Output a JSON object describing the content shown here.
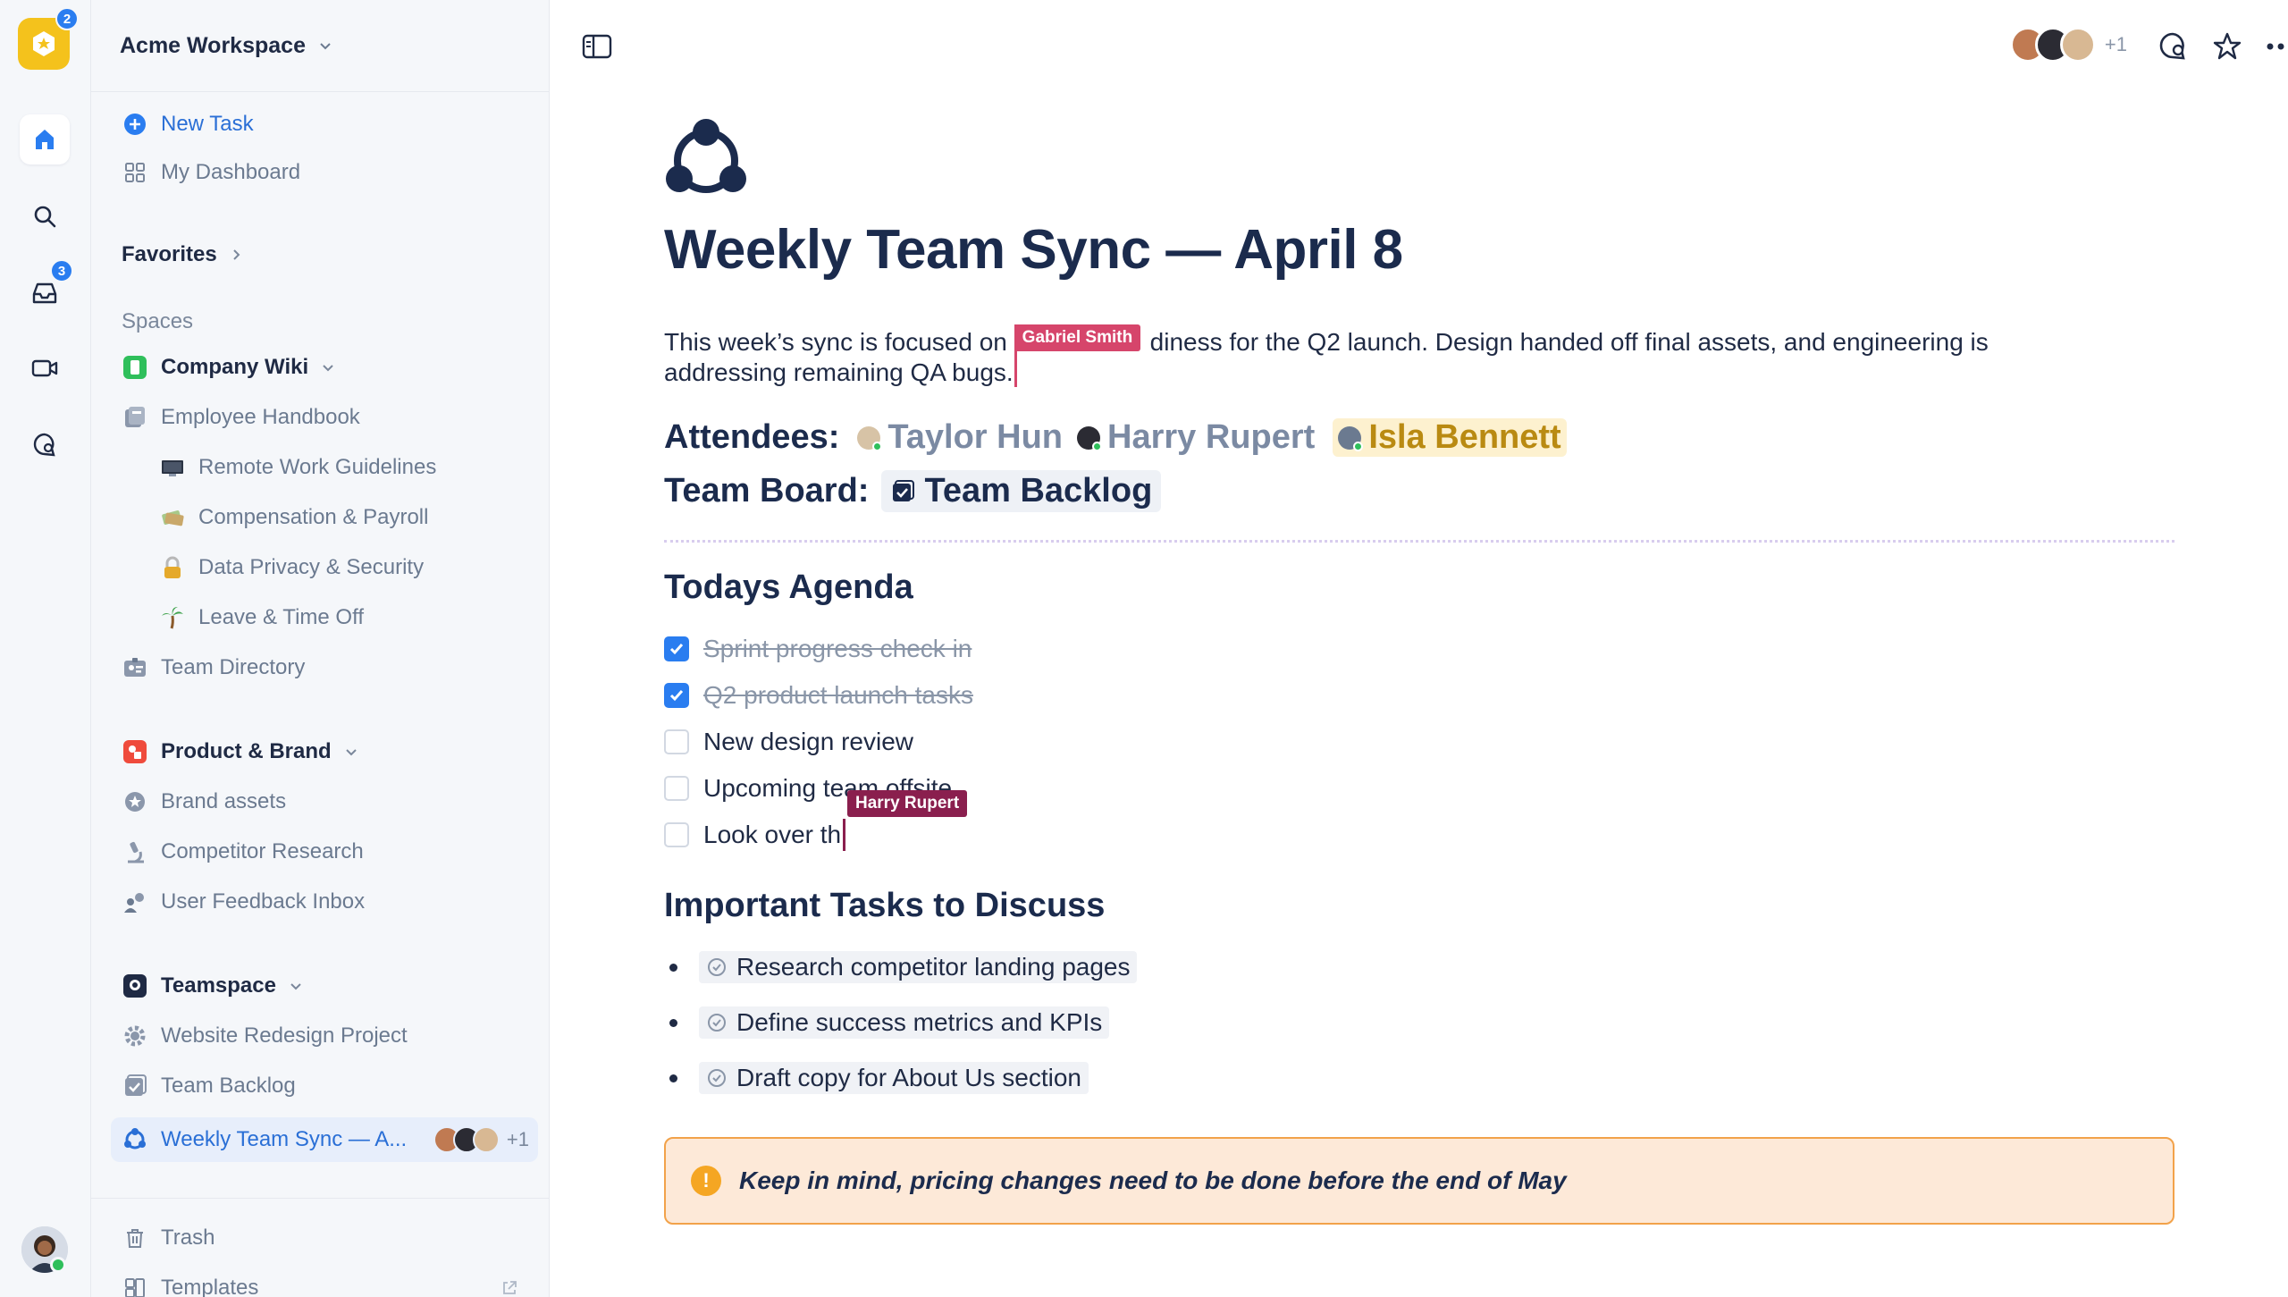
{
  "rail": {
    "logo_badge": "2",
    "inbox_badge": "3",
    "items": [
      "home",
      "search",
      "inbox",
      "video",
      "chat"
    ]
  },
  "sidebar": {
    "workspace_name": "Acme Workspace",
    "new_task": "New Task",
    "my_dashboard": "My Dashboard",
    "favorites": "Favorites",
    "spaces_label": "Spaces",
    "company_wiki": {
      "label": "Company Wiki",
      "items": [
        {
          "label": "Employee Handbook",
          "icon": "document-stack-icon"
        },
        {
          "label": "Remote Work Guidelines",
          "icon": "monitor-icon"
        },
        {
          "label": "Compensation & Payroll",
          "icon": "money-icon"
        },
        {
          "label": "Data Privacy & Security",
          "icon": "lock-icon"
        },
        {
          "label": "Leave & Time Off",
          "icon": "palm-tree-icon"
        },
        {
          "label": "Team Directory",
          "icon": "id-card-icon"
        }
      ]
    },
    "product_brand": {
      "label": "Product & Brand",
      "items": [
        {
          "label": "Brand assets",
          "icon": "badge-icon"
        },
        {
          "label": "Competitor Research",
          "icon": "microscope-icon"
        },
        {
          "label": "User Feedback Inbox",
          "icon": "people-icon"
        }
      ]
    },
    "teamspace": {
      "label": "Teamspace",
      "items": [
        {
          "label": "Website Redesign Project",
          "icon": "gear-icon"
        },
        {
          "label": "Team Backlog",
          "icon": "checkbox-board-icon"
        },
        {
          "label": "Weekly Team Sync — A...",
          "icon": "sync-icon",
          "presence_more": "+1"
        }
      ]
    },
    "trash": "Trash",
    "templates": "Templates"
  },
  "topbar": {
    "presence_more": "+1"
  },
  "doc": {
    "title": "Weekly Team Sync — April 8",
    "intro_before": "This week’s sync is focused on ",
    "intro_after": "diness for the Q2 launch. Design handed off final assets, and engineering is addressing remaining QA bugs.",
    "gabriel_cursor": "Gabriel Smith",
    "attendees_label": "Attendees:",
    "attendees": [
      "Taylor Hun",
      "Harry Rupert",
      "Isla Bennett"
    ],
    "board_label": "Team Board:",
    "board_link": "Team Backlog",
    "agenda_heading": "Todays Agenda",
    "agenda": [
      {
        "text": "Sprint progress check in",
        "done": true
      },
      {
        "text": "Q2 product launch tasks",
        "done": true
      },
      {
        "text": "New design review",
        "done": false
      },
      {
        "text": "Upcoming team offsite",
        "done": false
      },
      {
        "text": "Look over th",
        "done": false
      }
    ],
    "harry_cursor": "Harry Rupert",
    "tasks_heading": "Important Tasks to Discuss",
    "tasks": [
      "Research competitor landing pages",
      "Define success metrics and KPIs",
      "Draft copy for About Us section"
    ],
    "callout": "Keep in mind, pricing changes need to be done before the end of May"
  },
  "colors": {
    "accent": "#2a7df0",
    "gabriel_cursor": "#d6456b",
    "harry_cursor": "#8a1f4e",
    "mention_gold": "#b98a12",
    "callout_border": "#f2a24a",
    "callout_bg": "#fde9d8"
  }
}
